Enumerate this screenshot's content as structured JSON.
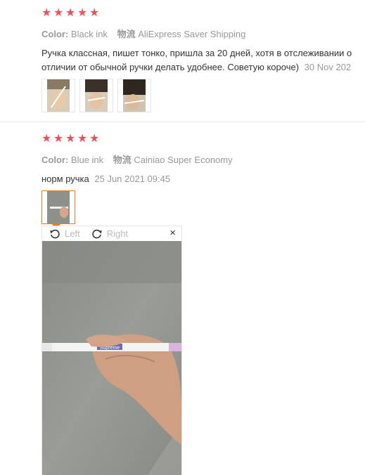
{
  "review1": {
    "stars": [
      "★",
      "★",
      "★",
      "★",
      "★"
    ],
    "color_label": "Color:",
    "color_value": "Black ink",
    "shipping_label": "物流",
    "shipping_value": "AliExpress Saver Shipping",
    "text_line1": "Ручка классная, пишет тонко, пришла за 20 дней, хотя в отслеживании о",
    "text_line2": "отличии от обычной ручки делать удобнее. Советую короче)",
    "date": "30 Nov 202",
    "photo_count": 3
  },
  "review2": {
    "stars": [
      "★",
      "★",
      "★",
      "★",
      "★"
    ],
    "color_label": "Color:",
    "color_value": "Blue ink",
    "shipping_label": "物流",
    "shipping_value": "Cainiao Super Economy",
    "text": "норм ручка",
    "date": "25 Jun 2021 09:45"
  },
  "viewer": {
    "left_label": "Left",
    "right_label": "Right",
    "close_label": "×",
    "pen_text": "Supreme"
  },
  "colors": {
    "star": "#f0505a",
    "accent": "#f07a1e"
  }
}
